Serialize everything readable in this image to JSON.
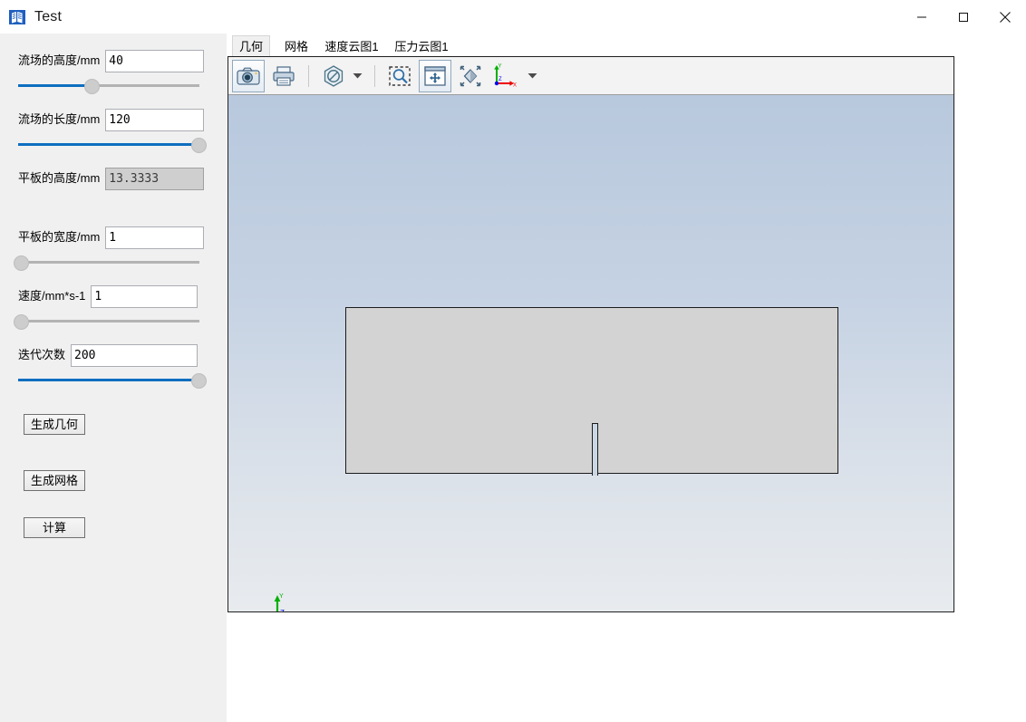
{
  "window": {
    "title": "Test",
    "icon": "app-pages-icon",
    "minimize_label": "—",
    "maximize_label": "□",
    "close_label": "✕"
  },
  "sidebar": {
    "controls": [
      {
        "label": "流场的高度/mm",
        "value": "40",
        "slider_percent": 40,
        "slider_filled": true,
        "disabled": false
      },
      {
        "label": "流场的长度/mm",
        "value": "120",
        "slider_percent": 99,
        "slider_filled": true,
        "disabled": false
      },
      {
        "label": "平板的高度/mm",
        "value": "13.3333",
        "slider_percent": null,
        "slider_filled": false,
        "disabled": true
      },
      {
        "label": "平板的宽度/mm",
        "value": "1",
        "slider_percent": 1,
        "slider_filled": false,
        "disabled": false
      },
      {
        "label": "速度/mm*s-1",
        "value": "1",
        "slider_percent": 1,
        "slider_filled": false,
        "disabled": false
      },
      {
        "label": "迭代次数",
        "value": "200",
        "slider_percent": 99,
        "slider_filled": true,
        "disabled": false
      }
    ],
    "buttons": [
      {
        "label": "生成几何",
        "name": "generate-geometry-button"
      },
      {
        "label": "生成网格",
        "name": "generate-mesh-button"
      },
      {
        "label": "计算",
        "name": "calculate-button"
      }
    ]
  },
  "tabs": [
    {
      "label": "几何",
      "active": true
    },
    {
      "label": "网格",
      "active": false
    },
    {
      "label": "速度云图1",
      "active": false
    },
    {
      "label": "压力云图1",
      "active": false
    }
  ],
  "toolbar": {
    "items": [
      {
        "name": "screenshot-camera-icon",
        "type": "button"
      },
      {
        "name": "print-icon",
        "type": "button"
      },
      {
        "name": "no-clipping-hexagon-icon",
        "type": "button"
      },
      {
        "name": "clipping-dropdown-caret-icon",
        "type": "caret"
      },
      {
        "name": "zoom-to-rectangle-icon",
        "type": "button"
      },
      {
        "name": "pan-fit-icon",
        "type": "button"
      },
      {
        "name": "rotate-view-icon",
        "type": "button"
      },
      {
        "name": "axis-orientation-icon",
        "type": "button"
      },
      {
        "name": "orientation-dropdown-caret-icon",
        "type": "caret"
      }
    ]
  },
  "viewport": {
    "geometry": {
      "name": "flow-field-rectangle",
      "plate_name": "flat-plate-slot"
    },
    "axis_gizmo": {
      "x_label": "X",
      "y_label": "Y",
      "z_label": "Z",
      "x_color": "#ee0000",
      "y_color": "#00b000",
      "z_color": "#0000ee"
    }
  }
}
